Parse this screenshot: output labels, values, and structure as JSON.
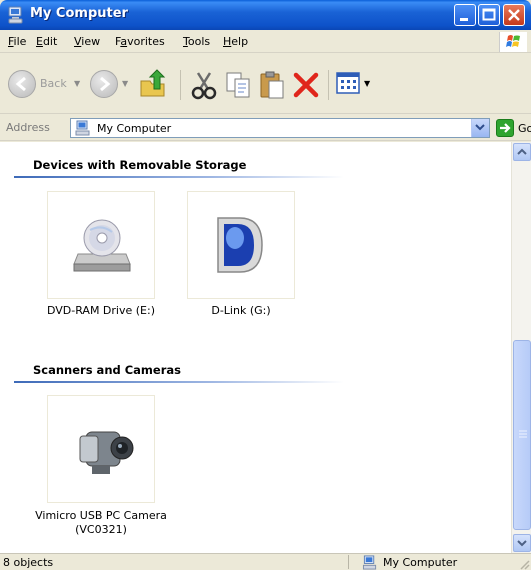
{
  "window": {
    "title": "My Computer",
    "title_bar_color": "#0A5FD8"
  },
  "menu": [
    {
      "label": "File",
      "accesskey": "F"
    },
    {
      "label": "Edit",
      "accesskey": "E"
    },
    {
      "label": "View",
      "accesskey": "V"
    },
    {
      "label": "Favorites",
      "accesskey": "a"
    },
    {
      "label": "Tools",
      "accesskey": "T"
    },
    {
      "label": "Help",
      "accesskey": "H"
    }
  ],
  "toolbar": {
    "back_label": "Back",
    "icons": [
      "back-icon",
      "forward-icon",
      "up-folder-icon",
      "cut-icon",
      "copy-icon",
      "paste-icon",
      "delete-icon",
      "views-icon"
    ]
  },
  "address": {
    "label": "Address",
    "value": "My Computer",
    "go_label": "Go"
  },
  "groups": [
    {
      "title": "Devices with Removable Storage",
      "items": [
        {
          "label": "DVD-RAM Drive (E:)",
          "icon": "dvd-drive-icon"
        },
        {
          "label": "D-Link (G:)",
          "icon": "dlink-drive-icon"
        }
      ]
    },
    {
      "title": "Scanners and Cameras",
      "items": [
        {
          "label": "Vimicro USB PC Camera (VC0321)",
          "icon": "camera-icon"
        }
      ]
    }
  ],
  "status": {
    "count": "8 objects",
    "location": "My Computer"
  }
}
